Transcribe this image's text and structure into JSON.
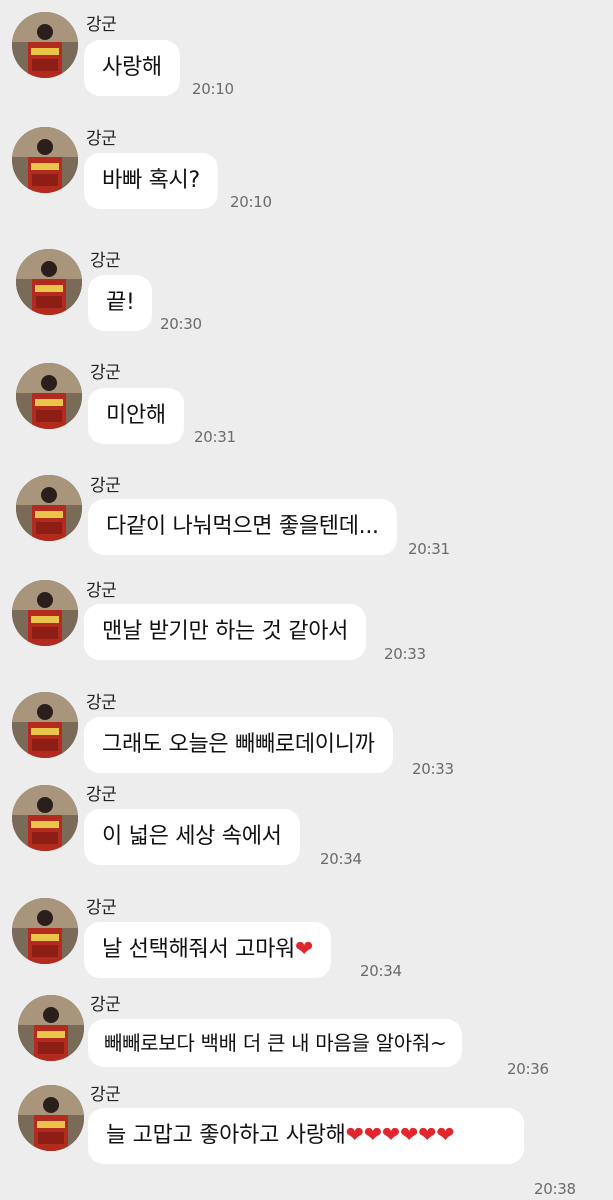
{
  "chat": {
    "messages": [
      {
        "sender": "강군",
        "text": "사랑해",
        "time": "20:10"
      },
      {
        "sender": "강군",
        "text": "바빠 혹시?",
        "time": "20:10"
      },
      {
        "sender": "강군",
        "text": "끝!",
        "time": "20:30"
      },
      {
        "sender": "강군",
        "text": "미안해",
        "time": "20:31"
      },
      {
        "sender": "강군",
        "text": "다같이 나눠먹으면 좋을텐데...",
        "time": "20:31"
      },
      {
        "sender": "강군",
        "text": "맨날 받기만 하는 것 같아서",
        "time": "20:33"
      },
      {
        "sender": "강군",
        "text": "그래도 오늘은 빼빼로데이니까",
        "time": "20:33"
      },
      {
        "sender": "강군",
        "text": "이 넓은 세상 속에서",
        "time": "20:34"
      },
      {
        "sender": "강군",
        "text": "날 선택해줘서 고마워❤️",
        "time": "20:34"
      },
      {
        "sender": "강군",
        "text": "빼빼로보다 백배 더 큰 내 마음을 알아줘~",
        "time": "20:36"
      },
      {
        "sender": "강군",
        "text": "늘 고맙고 좋아하고 사랑해❤️❤️❤️❤️❤️❤️",
        "time": "20:38"
      }
    ]
  },
  "colors": {
    "background": "#ededed",
    "bubble": "#ffffff",
    "heart": "#e2262e"
  },
  "icons": {
    "avatar": "profile-photo-avatar"
  }
}
